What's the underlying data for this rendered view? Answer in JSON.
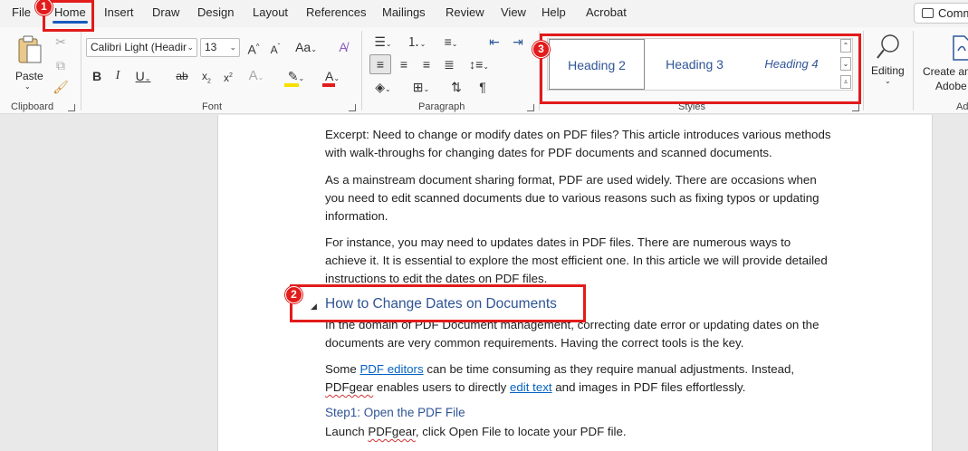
{
  "tabs": [
    {
      "label": "File"
    },
    {
      "label": "Home"
    },
    {
      "label": "Insert"
    },
    {
      "label": "Draw"
    },
    {
      "label": "Design"
    },
    {
      "label": "Layout"
    },
    {
      "label": "References"
    },
    {
      "label": "Mailings"
    },
    {
      "label": "Review"
    },
    {
      "label": "View"
    },
    {
      "label": "Help"
    },
    {
      "label": "Acrobat"
    }
  ],
  "active_tab": "Home",
  "comments_label": "Comm",
  "clipboard": {
    "paste_label": "Paste",
    "group_label": "Clipboard"
  },
  "font": {
    "name": "Calibri Light (Headir",
    "size": "13",
    "group_label": "Font",
    "highlight_color": "#f5e000",
    "font_color": "#e21b1b"
  },
  "paragraph": {
    "group_label": "Paragraph"
  },
  "styles": {
    "group_label": "Styles",
    "items": [
      {
        "label": "Heading 2"
      },
      {
        "label": "Heading 3"
      },
      {
        "label": "Heading 4"
      }
    ],
    "selected": "Heading 2"
  },
  "editing": {
    "label": "Editing"
  },
  "adobe": {
    "line1": "Create an",
    "line2": "Adobe",
    "group_label": "Ad"
  },
  "document": {
    "p1": "Excerpt: Need to change or modify dates on PDF files? This article introduces various methods with walk-throughs for changing dates for PDF documents and scanned documents.",
    "p2": "As a mainstream document sharing format, PDF are used widely. There are occasions when you need to edit scanned documents due to various reasons such as fixing typos or updating information.",
    "p3": "For instance, you may need to updates dates in PDF files. There are numerous ways to achieve it. It is essential to explore the most efficient one. In this article we will provide detailed instructions to edit the dates on PDF files.",
    "heading": "How to Change Dates on Documents",
    "p4": "In the domain of PDF Document management, correcting date error or updating dates on the documents are very common requirements. Having the correct tools is the key.",
    "p5_before": "Some ",
    "p5_link1": "PDF editors",
    "p5_mid1": " can be time consuming as they require manual adjustments. Instead, ",
    "p5_pdfgear": "PDFgear",
    "p5_mid2": " enables users to directly ",
    "p5_link2": "edit text",
    "p5_after": " and images in PDF files effortlessly.",
    "step_heading": "Step1: Open the PDF File",
    "p6_before": "Launch ",
    "p6_pdfgear": "PDFgear",
    "p6_after": ", click Open File to locate your PDF file."
  },
  "annotations": {
    "badge1": "1",
    "badge2": "2",
    "badge3": "3",
    "color": "#e21b1b"
  }
}
